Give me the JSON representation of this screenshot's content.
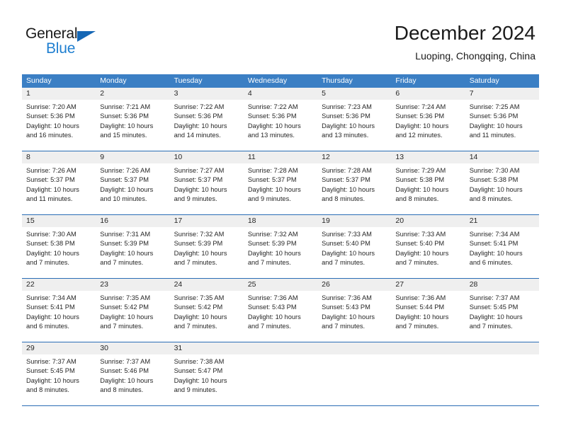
{
  "brand": {
    "name_top": "General",
    "name_bottom": "Blue",
    "triangle_color": "#1567b5",
    "blue_color": "#1f7fd0"
  },
  "header": {
    "title": "December 2024",
    "subtitle": "Luoping, Chongqing, China"
  },
  "colors": {
    "header_row_bg": "#3b7fc4",
    "day_band_bg": "#efefef",
    "row_border": "#2a6db5",
    "text": "#262626"
  },
  "weekdays": [
    "Sunday",
    "Monday",
    "Tuesday",
    "Wednesday",
    "Thursday",
    "Friday",
    "Saturday"
  ],
  "weeks": [
    [
      {
        "day": "1",
        "sunrise": "Sunrise: 7:20 AM",
        "sunset": "Sunset: 5:36 PM",
        "daylight_1": "Daylight: 10 hours",
        "daylight_2": "and 16 minutes."
      },
      {
        "day": "2",
        "sunrise": "Sunrise: 7:21 AM",
        "sunset": "Sunset: 5:36 PM",
        "daylight_1": "Daylight: 10 hours",
        "daylight_2": "and 15 minutes."
      },
      {
        "day": "3",
        "sunrise": "Sunrise: 7:22 AM",
        "sunset": "Sunset: 5:36 PM",
        "daylight_1": "Daylight: 10 hours",
        "daylight_2": "and 14 minutes."
      },
      {
        "day": "4",
        "sunrise": "Sunrise: 7:22 AM",
        "sunset": "Sunset: 5:36 PM",
        "daylight_1": "Daylight: 10 hours",
        "daylight_2": "and 13 minutes."
      },
      {
        "day": "5",
        "sunrise": "Sunrise: 7:23 AM",
        "sunset": "Sunset: 5:36 PM",
        "daylight_1": "Daylight: 10 hours",
        "daylight_2": "and 13 minutes."
      },
      {
        "day": "6",
        "sunrise": "Sunrise: 7:24 AM",
        "sunset": "Sunset: 5:36 PM",
        "daylight_1": "Daylight: 10 hours",
        "daylight_2": "and 12 minutes."
      },
      {
        "day": "7",
        "sunrise": "Sunrise: 7:25 AM",
        "sunset": "Sunset: 5:36 PM",
        "daylight_1": "Daylight: 10 hours",
        "daylight_2": "and 11 minutes."
      }
    ],
    [
      {
        "day": "8",
        "sunrise": "Sunrise: 7:26 AM",
        "sunset": "Sunset: 5:37 PM",
        "daylight_1": "Daylight: 10 hours",
        "daylight_2": "and 11 minutes."
      },
      {
        "day": "9",
        "sunrise": "Sunrise: 7:26 AM",
        "sunset": "Sunset: 5:37 PM",
        "daylight_1": "Daylight: 10 hours",
        "daylight_2": "and 10 minutes."
      },
      {
        "day": "10",
        "sunrise": "Sunrise: 7:27 AM",
        "sunset": "Sunset: 5:37 PM",
        "daylight_1": "Daylight: 10 hours",
        "daylight_2": "and 9 minutes."
      },
      {
        "day": "11",
        "sunrise": "Sunrise: 7:28 AM",
        "sunset": "Sunset: 5:37 PM",
        "daylight_1": "Daylight: 10 hours",
        "daylight_2": "and 9 minutes."
      },
      {
        "day": "12",
        "sunrise": "Sunrise: 7:28 AM",
        "sunset": "Sunset: 5:37 PM",
        "daylight_1": "Daylight: 10 hours",
        "daylight_2": "and 8 minutes."
      },
      {
        "day": "13",
        "sunrise": "Sunrise: 7:29 AM",
        "sunset": "Sunset: 5:38 PM",
        "daylight_1": "Daylight: 10 hours",
        "daylight_2": "and 8 minutes."
      },
      {
        "day": "14",
        "sunrise": "Sunrise: 7:30 AM",
        "sunset": "Sunset: 5:38 PM",
        "daylight_1": "Daylight: 10 hours",
        "daylight_2": "and 8 minutes."
      }
    ],
    [
      {
        "day": "15",
        "sunrise": "Sunrise: 7:30 AM",
        "sunset": "Sunset: 5:38 PM",
        "daylight_1": "Daylight: 10 hours",
        "daylight_2": "and 7 minutes."
      },
      {
        "day": "16",
        "sunrise": "Sunrise: 7:31 AM",
        "sunset": "Sunset: 5:39 PM",
        "daylight_1": "Daylight: 10 hours",
        "daylight_2": "and 7 minutes."
      },
      {
        "day": "17",
        "sunrise": "Sunrise: 7:32 AM",
        "sunset": "Sunset: 5:39 PM",
        "daylight_1": "Daylight: 10 hours",
        "daylight_2": "and 7 minutes."
      },
      {
        "day": "18",
        "sunrise": "Sunrise: 7:32 AM",
        "sunset": "Sunset: 5:39 PM",
        "daylight_1": "Daylight: 10 hours",
        "daylight_2": "and 7 minutes."
      },
      {
        "day": "19",
        "sunrise": "Sunrise: 7:33 AM",
        "sunset": "Sunset: 5:40 PM",
        "daylight_1": "Daylight: 10 hours",
        "daylight_2": "and 7 minutes."
      },
      {
        "day": "20",
        "sunrise": "Sunrise: 7:33 AM",
        "sunset": "Sunset: 5:40 PM",
        "daylight_1": "Daylight: 10 hours",
        "daylight_2": "and 7 minutes."
      },
      {
        "day": "21",
        "sunrise": "Sunrise: 7:34 AM",
        "sunset": "Sunset: 5:41 PM",
        "daylight_1": "Daylight: 10 hours",
        "daylight_2": "and 6 minutes."
      }
    ],
    [
      {
        "day": "22",
        "sunrise": "Sunrise: 7:34 AM",
        "sunset": "Sunset: 5:41 PM",
        "daylight_1": "Daylight: 10 hours",
        "daylight_2": "and 6 minutes."
      },
      {
        "day": "23",
        "sunrise": "Sunrise: 7:35 AM",
        "sunset": "Sunset: 5:42 PM",
        "daylight_1": "Daylight: 10 hours",
        "daylight_2": "and 7 minutes."
      },
      {
        "day": "24",
        "sunrise": "Sunrise: 7:35 AM",
        "sunset": "Sunset: 5:42 PM",
        "daylight_1": "Daylight: 10 hours",
        "daylight_2": "and 7 minutes."
      },
      {
        "day": "25",
        "sunrise": "Sunrise: 7:36 AM",
        "sunset": "Sunset: 5:43 PM",
        "daylight_1": "Daylight: 10 hours",
        "daylight_2": "and 7 minutes."
      },
      {
        "day": "26",
        "sunrise": "Sunrise: 7:36 AM",
        "sunset": "Sunset: 5:43 PM",
        "daylight_1": "Daylight: 10 hours",
        "daylight_2": "and 7 minutes."
      },
      {
        "day": "27",
        "sunrise": "Sunrise: 7:36 AM",
        "sunset": "Sunset: 5:44 PM",
        "daylight_1": "Daylight: 10 hours",
        "daylight_2": "and 7 minutes."
      },
      {
        "day": "28",
        "sunrise": "Sunrise: 7:37 AM",
        "sunset": "Sunset: 5:45 PM",
        "daylight_1": "Daylight: 10 hours",
        "daylight_2": "and 7 minutes."
      }
    ],
    [
      {
        "day": "29",
        "sunrise": "Sunrise: 7:37 AM",
        "sunset": "Sunset: 5:45 PM",
        "daylight_1": "Daylight: 10 hours",
        "daylight_2": "and 8 minutes."
      },
      {
        "day": "30",
        "sunrise": "Sunrise: 7:37 AM",
        "sunset": "Sunset: 5:46 PM",
        "daylight_1": "Daylight: 10 hours",
        "daylight_2": "and 8 minutes."
      },
      {
        "day": "31",
        "sunrise": "Sunrise: 7:38 AM",
        "sunset": "Sunset: 5:47 PM",
        "daylight_1": "Daylight: 10 hours",
        "daylight_2": "and 9 minutes."
      },
      {
        "day": "",
        "sunrise": "",
        "sunset": "",
        "daylight_1": "",
        "daylight_2": ""
      },
      {
        "day": "",
        "sunrise": "",
        "sunset": "",
        "daylight_1": "",
        "daylight_2": ""
      },
      {
        "day": "",
        "sunrise": "",
        "sunset": "",
        "daylight_1": "",
        "daylight_2": ""
      },
      {
        "day": "",
        "sunrise": "",
        "sunset": "",
        "daylight_1": "",
        "daylight_2": ""
      }
    ]
  ]
}
